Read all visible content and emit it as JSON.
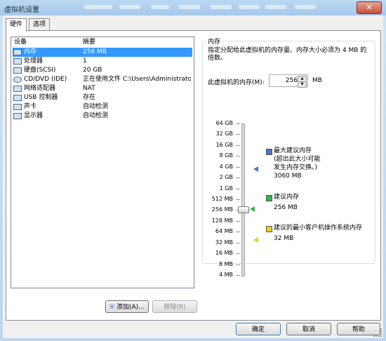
{
  "window": {
    "title": "虚拟机设置",
    "close": "✕"
  },
  "tabs": [
    {
      "label": "硬件"
    },
    {
      "label": "选项"
    }
  ],
  "device_list": {
    "headers": {
      "device": "设备",
      "summary": "摘要"
    },
    "items": [
      {
        "device": "内存",
        "summary": "256 MB",
        "icon": "memory-icon"
      },
      {
        "device": "处理器",
        "summary": "1",
        "icon": "cpu-icon"
      },
      {
        "device": "硬盘(SCSI)",
        "summary": "20 GB",
        "icon": "harddisk-icon"
      },
      {
        "device": "CD/DVD (IDE)",
        "summary": "正在使用文件 C:\\Users\\Administrato...",
        "icon": "cdrom-icon"
      },
      {
        "device": "网络适配器",
        "summary": "NAT",
        "icon": "network-icon"
      },
      {
        "device": "USB 控制器",
        "summary": "存在",
        "icon": "usb-icon"
      },
      {
        "device": "声卡",
        "summary": "自动检测",
        "icon": "sound-icon"
      },
      {
        "device": "显示器",
        "summary": "自动检测",
        "icon": "display-icon"
      }
    ]
  },
  "buttons": {
    "add": "添加(A)...",
    "remove": "移除(R)",
    "ok": "确定",
    "cancel": "取消",
    "help": "帮助"
  },
  "memory": {
    "group_title": "内存",
    "description": "指定分配给此虚拟机的内存量。内存大小必须为 4 MB 的倍数。",
    "field_label": "此虚拟机的内存(M):",
    "value": "256",
    "unit": "MB",
    "scale": [
      "64 GB",
      "32 GB",
      "16 GB",
      "8 GB",
      "4 GB",
      "2 GB",
      "1 GB",
      "512 MB",
      "256 MB",
      "128 MB",
      "64 MB",
      "32 MB",
      "16 MB",
      "8 MB",
      "4 MB"
    ],
    "legend": [
      {
        "title": "最大建议内存",
        "note": "(超出此大小可能发生内存交换。)",
        "value": "3060 MB",
        "color": "#4a78c2"
      },
      {
        "title": "建议内存",
        "value": "256 MB",
        "color": "#2fb84a"
      },
      {
        "title": "建议的最小客户机操作系统内存",
        "value": "32 MB",
        "color": "#e6d21a"
      }
    ]
  }
}
